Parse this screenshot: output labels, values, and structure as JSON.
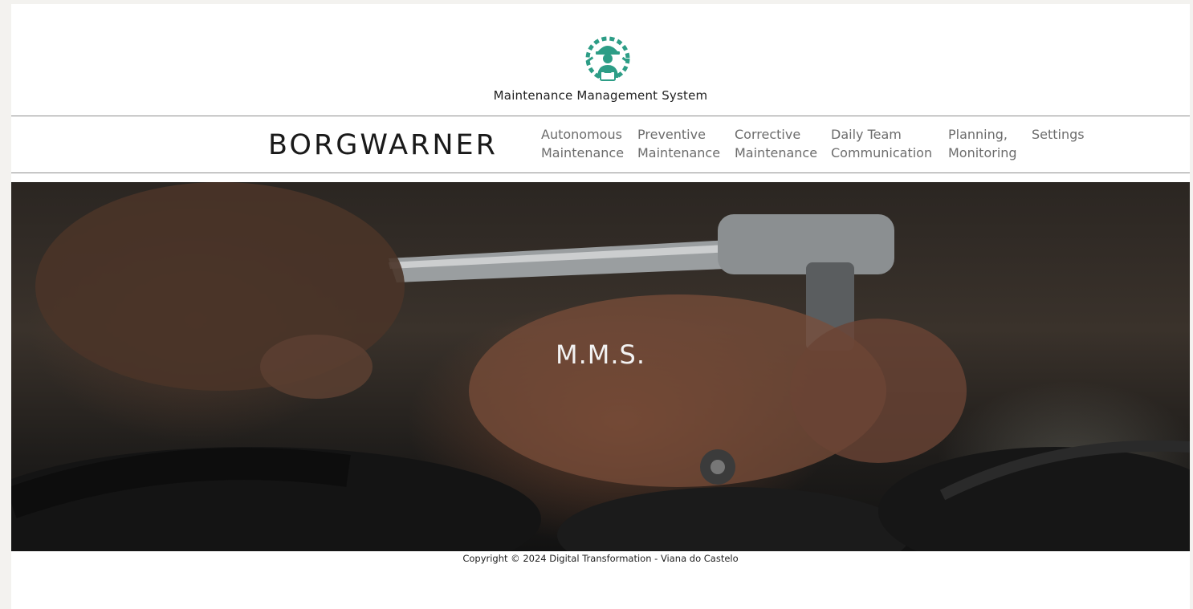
{
  "header": {
    "logo_icon": "maintenance-worker-gears-icon",
    "system_title": "Maintenance Management System"
  },
  "nav": {
    "brand": "BORGWARNER",
    "items": [
      {
        "line1": "Autonomous",
        "line2": "Maintenance"
      },
      {
        "line1": "Preventive",
        "line2": "Maintenance"
      },
      {
        "line1": "Corrective",
        "line2": "Maintenance"
      },
      {
        "line1": "Daily Team",
        "line2": "Communication"
      },
      {
        "line1": "Planning,",
        "line2": "Monitoring"
      },
      {
        "line1": "Settings",
        "line2": ""
      }
    ]
  },
  "hero": {
    "title": "M.M.S."
  },
  "footer": {
    "copyright": "Copyright © 2024 Digital Transformation - Viana do Castelo"
  },
  "colors": {
    "logo_teal": "#2d9d86",
    "nav_text": "#6c6c6c",
    "brand_text": "#1a1a1a"
  }
}
